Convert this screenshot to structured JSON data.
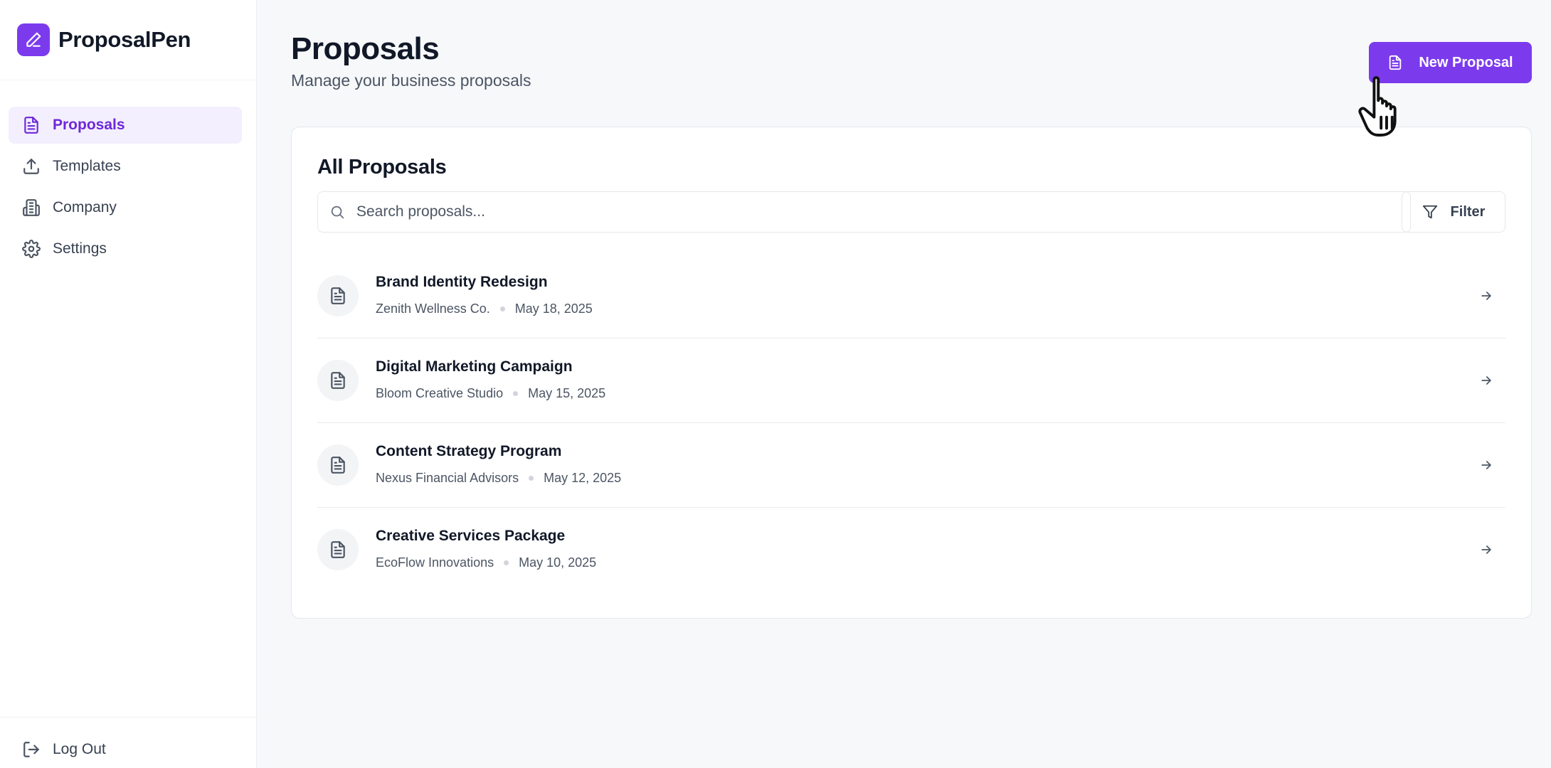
{
  "app": {
    "name": "ProposalPen",
    "logo_icon": "pen-icon",
    "accent": "#7c3aed"
  },
  "sidebar": {
    "items": [
      {
        "label": "Proposals",
        "icon": "file-text-icon",
        "active": true
      },
      {
        "label": "Templates",
        "icon": "upload-icon",
        "active": false
      },
      {
        "label": "Company",
        "icon": "building-icon",
        "active": false
      },
      {
        "label": "Settings",
        "icon": "gear-icon",
        "active": false
      }
    ],
    "logout_label": "Log Out"
  },
  "header": {
    "title": "Proposals",
    "subtitle": "Manage your business proposals",
    "new_button_label": "New Proposal"
  },
  "card": {
    "title": "All Proposals",
    "search_placeholder": "Search proposals...",
    "filter_label": "Filter"
  },
  "proposals": [
    {
      "title": "Brand Identity Redesign",
      "client": "Zenith Wellness Co.",
      "date": "May 18, 2025"
    },
    {
      "title": "Digital Marketing Campaign",
      "client": "Bloom Creative Studio",
      "date": "May 15, 2025"
    },
    {
      "title": "Content Strategy Program",
      "client": "Nexus Financial Advisors",
      "date": "May 12, 2025"
    },
    {
      "title": "Creative Services Package",
      "client": "EcoFlow Innovations",
      "date": "May 10, 2025"
    }
  ]
}
